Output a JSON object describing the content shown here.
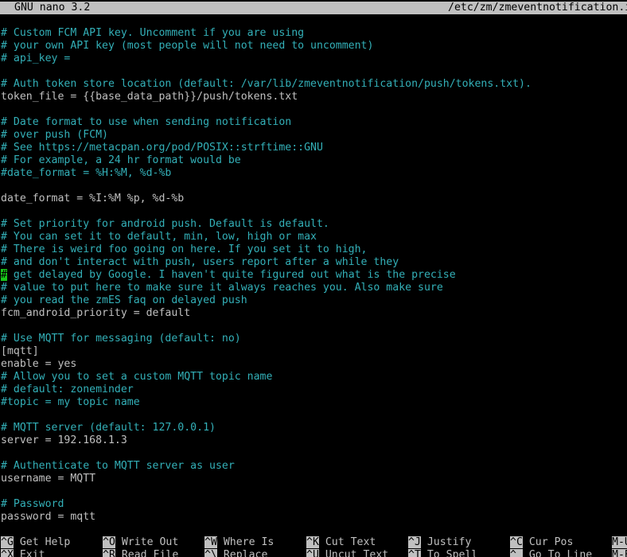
{
  "title_bar": {
    "app_version": "GNU nano 3.2",
    "filename": "/etc/zm/zmeventnotification.i"
  },
  "lines": [
    {
      "type": "comment",
      "text": "# Custom FCM API key. Uncomment if you are using"
    },
    {
      "type": "comment",
      "text": "# your own API key (most people will not need to uncomment)"
    },
    {
      "type": "comment",
      "text": "# api_key ="
    },
    {
      "type": "blank",
      "text": ""
    },
    {
      "type": "comment",
      "text": "# Auth token store location (default: /var/lib/zmeventnotification/push/tokens.txt)."
    },
    {
      "type": "setting",
      "text": "token_file = {{base_data_path}}/push/tokens.txt"
    },
    {
      "type": "blank",
      "text": ""
    },
    {
      "type": "comment",
      "text": "# Date format to use when sending notification"
    },
    {
      "type": "comment",
      "text": "# over push (FCM)"
    },
    {
      "type": "comment",
      "text": "# See https://metacpan.org/pod/POSIX::strftime::GNU"
    },
    {
      "type": "comment",
      "text": "# For example, a 24 hr format would be"
    },
    {
      "type": "comment",
      "text": "#date_format = %H:%M, %d-%b"
    },
    {
      "type": "blank",
      "text": ""
    },
    {
      "type": "setting",
      "text": "date_format = %I:%M %p, %d-%b"
    },
    {
      "type": "blank",
      "text": ""
    },
    {
      "type": "comment",
      "text": "# Set priority for android push. Default is default."
    },
    {
      "type": "comment",
      "text": "# You can set it to default, min, low, high or max"
    },
    {
      "type": "comment",
      "text": "# There is weird foo going on here. If you set it to high,"
    },
    {
      "type": "comment",
      "text": "# and don't interact with push, users report after a while they"
    },
    {
      "type": "cursor",
      "cursor_char": "#",
      "text": " get delayed by Google. I haven't quite figured out what is the precise"
    },
    {
      "type": "comment",
      "text": "# value to put here to make sure it always reaches you. Also make sure"
    },
    {
      "type": "comment",
      "text": "# you read the zmES faq on delayed push"
    },
    {
      "type": "setting",
      "text": "fcm_android_priority = default"
    },
    {
      "type": "blank",
      "text": ""
    },
    {
      "type": "comment",
      "text": "# Use MQTT for messaging (default: no)"
    },
    {
      "type": "setting",
      "text": "[mqtt]"
    },
    {
      "type": "setting",
      "text": "enable = yes"
    },
    {
      "type": "comment",
      "text": "# Allow you to set a custom MQTT topic name"
    },
    {
      "type": "comment",
      "text": "# default: zoneminder"
    },
    {
      "type": "comment",
      "text": "#topic = my topic name"
    },
    {
      "type": "blank",
      "text": ""
    },
    {
      "type": "comment",
      "text": "# MQTT server (default: 127.0.0.1)"
    },
    {
      "type": "setting",
      "text": "server = 192.168.1.3"
    },
    {
      "type": "blank",
      "text": ""
    },
    {
      "type": "comment",
      "text": "# Authenticate to MQTT server as user"
    },
    {
      "type": "setting",
      "text": "username = MQTT"
    },
    {
      "type": "blank",
      "text": ""
    },
    {
      "type": "comment",
      "text": "# Password"
    },
    {
      "type": "setting",
      "text": "password = mqtt"
    }
  ],
  "shortcuts": {
    "row1": [
      {
        "key": "^G",
        "label": "Get Help"
      },
      {
        "key": "^O",
        "label": "Write Out"
      },
      {
        "key": "^W",
        "label": "Where Is"
      },
      {
        "key": "^K",
        "label": "Cut Text"
      },
      {
        "key": "^J",
        "label": "Justify"
      },
      {
        "key": "^C",
        "label": "Cur Pos"
      },
      {
        "key": "M-U",
        "label": ""
      }
    ],
    "row2": [
      {
        "key": "^X",
        "label": "Exit"
      },
      {
        "key": "^R",
        "label": "Read File"
      },
      {
        "key": "^\\",
        "label": "Replace"
      },
      {
        "key": "^U",
        "label": "Uncut Text"
      },
      {
        "key": "^T",
        "label": "To Spell"
      },
      {
        "key": "^_",
        "label": "Go To Line"
      },
      {
        "key": "M-E",
        "label": ""
      }
    ]
  },
  "colors": {
    "comment": "#33b0b8",
    "text": "#c0c0c0",
    "background": "#000000",
    "cursor": "#19c719",
    "inverse_bar": "#c0c0c0"
  }
}
